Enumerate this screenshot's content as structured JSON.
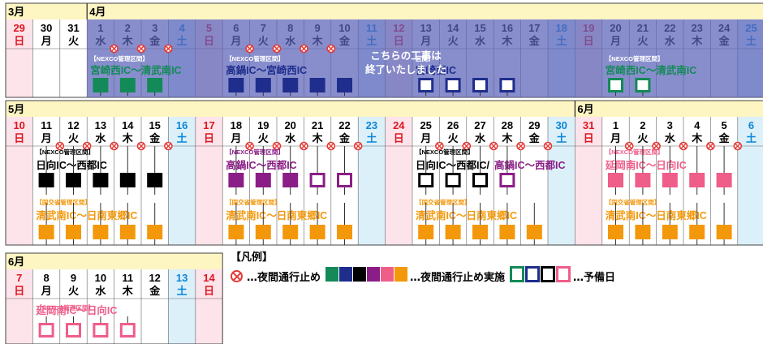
{
  "colors": {
    "green": "#138a57",
    "navy": "#1f2d8c",
    "black": "#000000",
    "purple": "#8b1e86",
    "pink": "#ef5d89",
    "orange": "#f3980b",
    "header": "#fdf5c2",
    "sat": "#0b86d8",
    "sun": "#e0151f",
    "sunBg": "#fde4ea",
    "satBg": "#dcf0fa",
    "band": "#5a62b8"
  },
  "months": {
    "m3": "3月",
    "m4": "4月",
    "m5": "5月",
    "m6": "6月"
  },
  "weekdays": {
    "mon": "月",
    "tue": "火",
    "wed": "水",
    "thu": "木",
    "fri": "金",
    "sat": "土",
    "sun": "日"
  },
  "legend": {
    "title": "【凡例】",
    "stop_text": "…夜間通行止め",
    "swatches": [
      "green",
      "navy",
      "black",
      "purple",
      "pink",
      "orange"
    ],
    "work_text": "…夜間通行止め実施",
    "boxes": [
      "green",
      "navy",
      "black",
      "pink"
    ],
    "reserve_text": "…予備日"
  },
  "cal": {
    "week1": {
      "month_labels": [
        {
          "key": "m3",
          "col": 0
        },
        {
          "key": "m4",
          "col": 3
        }
      ],
      "days": [
        {
          "d": "29",
          "w": "sun"
        },
        {
          "d": "30",
          "w": "mon"
        },
        {
          "d": "31",
          "w": "tue"
        },
        {
          "d": "1",
          "w": "wed"
        },
        {
          "d": "2",
          "w": "thu"
        },
        {
          "d": "3",
          "w": "fri"
        },
        {
          "d": "4",
          "w": "sat"
        },
        {
          "d": "5",
          "w": "sun"
        },
        {
          "d": "6",
          "w": "mon"
        },
        {
          "d": "7",
          "w": "tue"
        },
        {
          "d": "8",
          "w": "wed"
        },
        {
          "d": "9",
          "w": "thu"
        },
        {
          "d": "10",
          "w": "fri"
        },
        {
          "d": "11",
          "w": "sat"
        },
        {
          "d": "12",
          "w": "sun"
        },
        {
          "d": "13",
          "w": "mon"
        },
        {
          "d": "14",
          "w": "tue"
        },
        {
          "d": "15",
          "w": "wed"
        },
        {
          "d": "16",
          "w": "thu"
        },
        {
          "d": "17",
          "w": "fri"
        },
        {
          "d": "18",
          "w": "sat"
        },
        {
          "d": "19",
          "w": "sun"
        },
        {
          "d": "20",
          "w": "mon"
        },
        {
          "d": "21",
          "w": "tue"
        },
        {
          "d": "22",
          "w": "wed"
        },
        {
          "d": "23",
          "w": "thu"
        },
        {
          "d": "24",
          "w": "fri"
        },
        {
          "d": "25",
          "w": "sat"
        }
      ],
      "stops": [
        4,
        5,
        6,
        9,
        10,
        11,
        12
      ],
      "completed_note": [
        "こちらの工事は",
        "終了いたしました"
      ],
      "groups": [
        {
          "tag": "【NEXCO管理区間】",
          "route": "宮崎西IC～清武南IC",
          "color": "green",
          "cols": [
            3,
            4,
            5
          ],
          "boxes": [
            "w",
            "w",
            "w"
          ]
        },
        {
          "tag": "【NEXCO管理区間】",
          "route": "高鍋IC～宮崎西IC",
          "color": "navy",
          "cols": [
            8,
            9,
            10,
            11,
            12
          ],
          "boxes": [
            "w",
            "w",
            "w",
            "w",
            "w"
          ]
        },
        {
          "tag": "区間】",
          "route": "宮崎西IC",
          "color": "navy",
          "cols": [
            15,
            16,
            17,
            18
          ],
          "boxes": [
            "r",
            "r",
            "r",
            "r"
          ]
        },
        {
          "tag": "【NEXCO管理区間】",
          "route": "宮崎西IC～清武南IC",
          "color": "green",
          "cols": [
            22,
            23
          ],
          "boxes": [
            "r",
            "r"
          ]
        }
      ]
    },
    "week2": {
      "month_labels": [
        {
          "key": "m5",
          "col": 0
        },
        {
          "key": "m6",
          "col": 21
        }
      ],
      "days": [
        {
          "d": "10",
          "w": "sun"
        },
        {
          "d": "11",
          "w": "mon"
        },
        {
          "d": "12",
          "w": "tue"
        },
        {
          "d": "13",
          "w": "wed"
        },
        {
          "d": "14",
          "w": "thu"
        },
        {
          "d": "15",
          "w": "fri"
        },
        {
          "d": "16",
          "w": "sat"
        },
        {
          "d": "17",
          "w": "sun"
        },
        {
          "d": "18",
          "w": "mon"
        },
        {
          "d": "19",
          "w": "tue"
        },
        {
          "d": "20",
          "w": "wed"
        },
        {
          "d": "21",
          "w": "thu"
        },
        {
          "d": "22",
          "w": "fri"
        },
        {
          "d": "23",
          "w": "sat"
        },
        {
          "d": "24",
          "w": "sun"
        },
        {
          "d": "25",
          "w": "mon"
        },
        {
          "d": "26",
          "w": "tue"
        },
        {
          "d": "27",
          "w": "wed"
        },
        {
          "d": "28",
          "w": "thu"
        },
        {
          "d": "29",
          "w": "fri"
        },
        {
          "d": "30",
          "w": "sat"
        },
        {
          "d": "31",
          "w": "sun"
        },
        {
          "d": "1",
          "w": "mon"
        },
        {
          "d": "2",
          "w": "tue"
        },
        {
          "d": "3",
          "w": "wed"
        },
        {
          "d": "4",
          "w": "thu"
        },
        {
          "d": "5",
          "w": "fri"
        },
        {
          "d": "6",
          "w": "sat"
        }
      ],
      "stops": [
        2,
        3,
        4,
        5,
        6,
        9,
        10,
        11,
        12,
        13,
        16,
        17,
        18,
        19,
        20,
        23,
        24,
        25,
        26,
        27
      ],
      "groups": [
        {
          "tag": "【NEXCO管理区間】",
          "route": "日向IC～西都IC",
          "color": "black",
          "cols": [
            1,
            2,
            3,
            4,
            5
          ],
          "boxes": [
            "w",
            "w",
            "w",
            "w",
            "w"
          ]
        },
        {
          "tag": "【国交省管理区間】",
          "route": "清武南IC～日南東郷IC",
          "color": "orange",
          "cols": [
            1,
            2,
            3,
            4,
            5
          ],
          "boxes": [
            "w",
            "w",
            "w",
            "w",
            "w"
          ]
        },
        {
          "tag": "【NEXCO管理区間】",
          "route": "高鍋IC～西都IC",
          "color": "purple",
          "cols": [
            8,
            9,
            10,
            11,
            12
          ],
          "boxes": [
            "w",
            "w",
            "w",
            "r",
            "r"
          ]
        },
        {
          "tag": "【国交省管理区間】",
          "route": "清武南IC～日南東郷IC",
          "color": "orange",
          "cols": [
            8,
            9,
            10,
            11,
            12
          ],
          "boxes": [
            "w",
            "w",
            "w",
            "w",
            "w"
          ]
        },
        {
          "tag": "【NEXCO管理区間】",
          "route": "日向IC～西都IC/",
          "route2": "高鍋IC～西都IC",
          "color": "black",
          "color2": "purple",
          "cols": [
            15,
            16,
            17,
            18
          ],
          "boxes": [
            "r",
            "r",
            "r",
            "r2"
          ]
        },
        {
          "tag": "【国交省管理区間】",
          "route": "清武南IC～日南東郷IC",
          "color": "orange",
          "cols": [
            15,
            16,
            17,
            18,
            19
          ],
          "boxes": [
            "w",
            "w",
            "w",
            "w",
            "w"
          ]
        },
        {
          "tag": "【NEXCO管理区間】",
          "route": "延岡南IC～日向IC",
          "color": "pink",
          "cols": [
            22,
            23,
            24,
            25,
            26
          ],
          "boxes": [
            "w",
            "w",
            "w",
            "w",
            "w"
          ]
        },
        {
          "tag": "【国交省管理区間】",
          "route": "清武南IC～日南東郷IC",
          "color": "orange",
          "cols": [
            22,
            23,
            24,
            25,
            26
          ],
          "boxes": [
            "w",
            "w",
            "w",
            "w",
            "w"
          ]
        }
      ]
    },
    "week3": {
      "month_labels": [
        {
          "key": "m6",
          "col": 0
        }
      ],
      "days": [
        {
          "d": "7",
          "w": "sun"
        },
        {
          "d": "8",
          "w": "mon"
        },
        {
          "d": "9",
          "w": "tue"
        },
        {
          "d": "10",
          "w": "wed"
        },
        {
          "d": "11",
          "w": "thu"
        },
        {
          "d": "12",
          "w": "fri"
        },
        {
          "d": "13",
          "w": "sat"
        },
        {
          "d": "14",
          "w": "sun"
        }
      ],
      "groups": [
        {
          "tag": "【NEXCO管理区間】",
          "route": "延岡南IC～日向IC",
          "color": "pink",
          "cols": [
            1,
            2,
            3,
            4
          ],
          "boxes": [
            "r",
            "r",
            "r",
            "r"
          ]
        }
      ]
    }
  }
}
